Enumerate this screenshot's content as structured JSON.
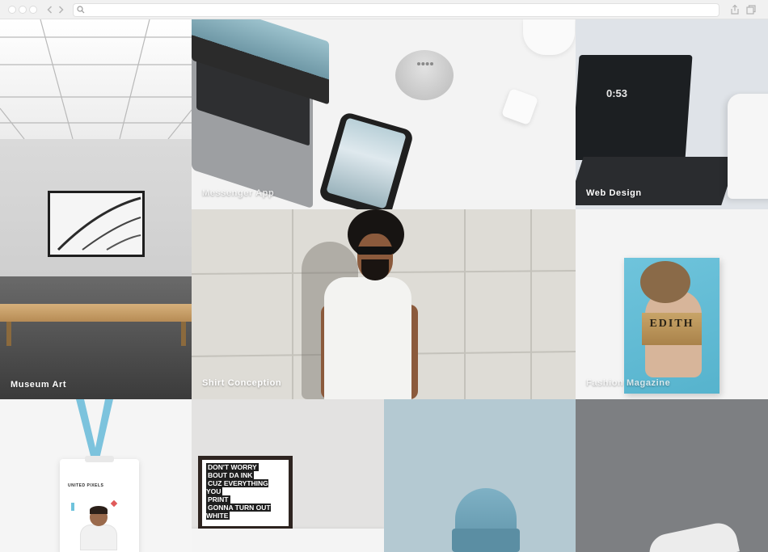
{
  "browser": {
    "url_value": "",
    "icons": [
      "back-arrow-icon",
      "forward-arrow-icon",
      "search-icon",
      "share-icon",
      "tabs-icon"
    ]
  },
  "gallery": {
    "tiles": [
      {
        "id": "museum",
        "caption": "Museum Art"
      },
      {
        "id": "messenger",
        "caption": "Messenger App"
      },
      {
        "id": "webdesign",
        "caption": "Web Design",
        "clock": "0:53"
      },
      {
        "id": "shirt",
        "caption": "Shirt Conception"
      },
      {
        "id": "fashion",
        "caption": "Fashion Magazine",
        "magazine_title": "EDITH"
      },
      {
        "id": "badge",
        "caption": "",
        "badge_org": "UNITED PIXELS"
      },
      {
        "id": "frame",
        "caption": "",
        "quote_lines": [
          "DON'T WORRY",
          "BOUT DA INK",
          "CUZ EVERYTHING YOU",
          "PRINT",
          "GONNA TURN OUT WHITE"
        ]
      },
      {
        "id": "beanie",
        "caption": ""
      },
      {
        "id": "grey",
        "caption": ""
      }
    ]
  },
  "colors": {
    "chrome_bg": "#f1f1f1",
    "caption_text": "#ffffff"
  }
}
